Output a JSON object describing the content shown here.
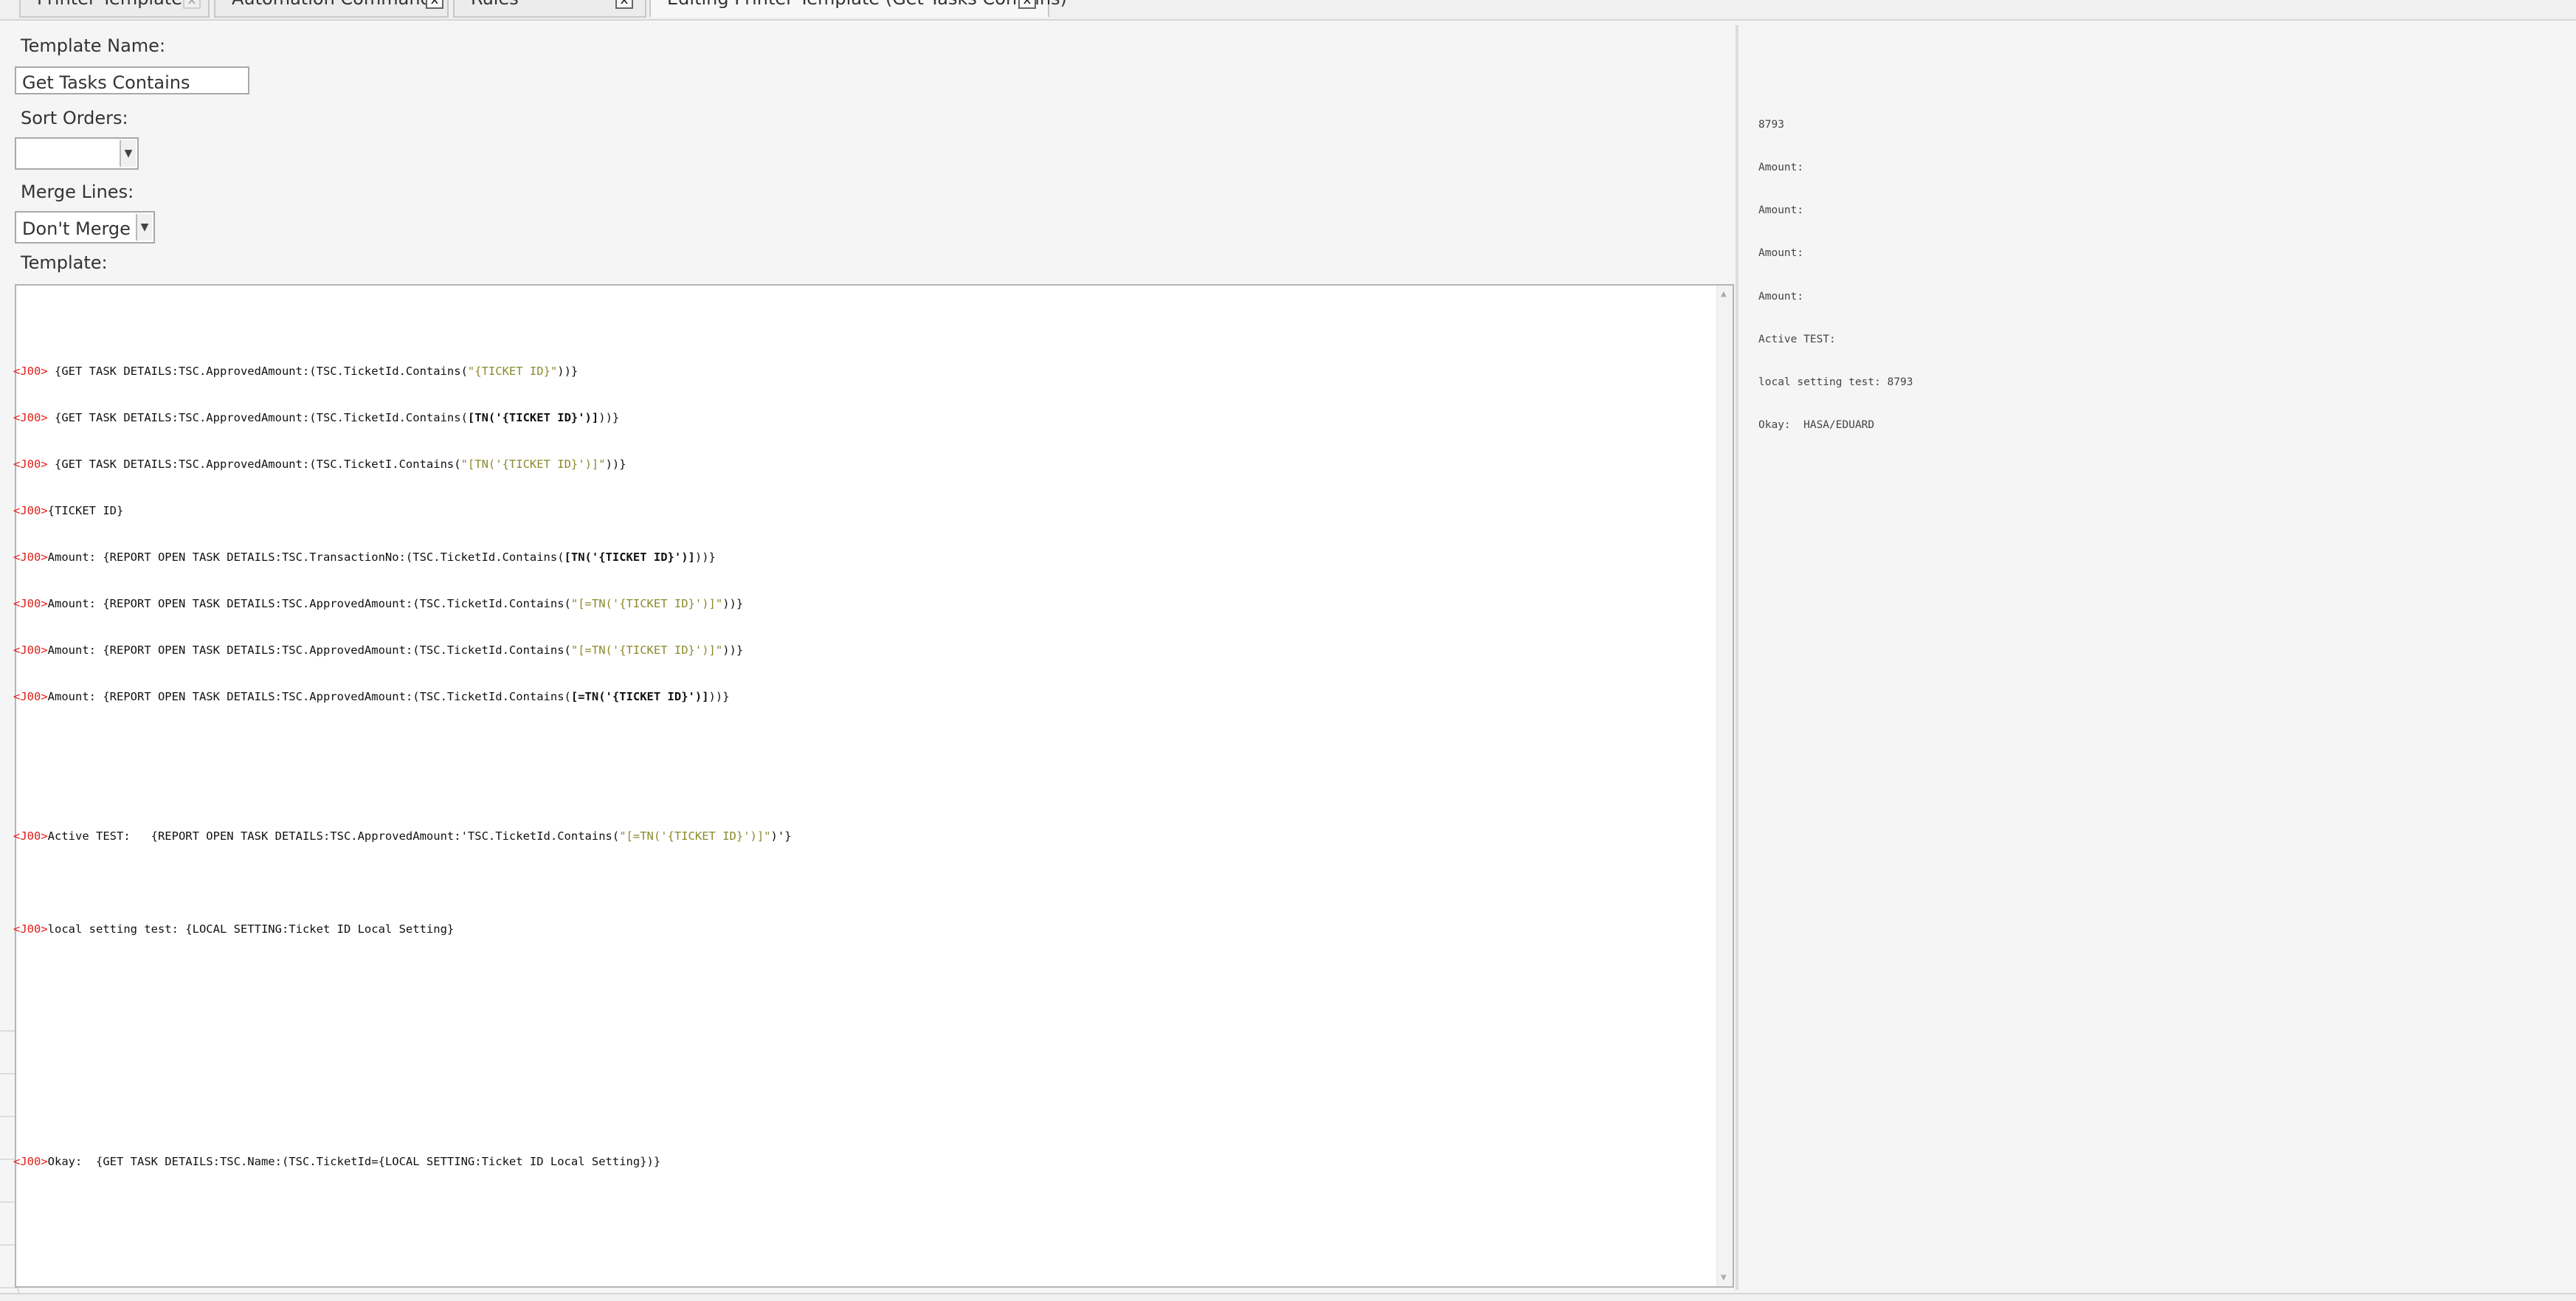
{
  "tabs": [
    {
      "label": "Printer Templates",
      "close": "x"
    },
    {
      "label": "Automation Commands",
      "close": "x"
    },
    {
      "label": "Rules",
      "close": "x"
    },
    {
      "label": "Editing Printer Template (Get Tasks Contains)",
      "close": "x"
    }
  ],
  "form": {
    "template_name_label": "Template Name:",
    "template_name_value": "Get Tasks Contains",
    "sort_orders_label": "Sort Orders:",
    "sort_orders_value": "",
    "merge_lines_label": "Merge Lines:",
    "merge_lines_value": "Don't Merge",
    "template_label": "Template:"
  },
  "template_lines": {
    "l1": {
      "tag": "<J00>",
      "a": " {GET TASK DETAILS:TSC.ApprovedAmount:(TSC.TicketId.Contains(",
      "s": "\"{TICKET ID}\"",
      "b": "))}"
    },
    "l2": {
      "tag": "<J00>",
      "a": " {GET TASK DETAILS:TSC.ApprovedAmount:(TSC.TicketId.Contains(",
      "bold": "[TN('{TICKET ID}')]",
      "b": "))}"
    },
    "l3": {
      "tag": "<J00>",
      "a": " {GET TASK DETAILS:TSC.ApprovedAmount:(TSC.TicketI.Contains(",
      "s": "\"[TN('{TICKET ID}')]\"",
      "b": "))}"
    },
    "l4": {
      "tag": "<J00>",
      "a": "{TICKET ID}"
    },
    "l5": {
      "tag": "<J00>",
      "a": "Amount: {REPORT OPEN TASK DETAILS:TSC.TransactionNo:(TSC.TicketId.Contains(",
      "bold": "[TN('{TICKET ID}')]",
      "b": "))}"
    },
    "l6": {
      "tag": "<J00>",
      "a": "Amount: {REPORT OPEN TASK DETAILS:TSC.ApprovedAmount:(TSC.TicketId.Contains(",
      "s": "\"[=TN('{TICKET ID}')]\"",
      "b": "))}"
    },
    "l7": {
      "tag": "<J00>",
      "a": "Amount: {REPORT OPEN TASK DETAILS:TSC.ApprovedAmount:(TSC.TicketId.Contains(",
      "s": "\"[=TN('{TICKET ID}')]\"",
      "b": "))}"
    },
    "l8": {
      "tag": "<J00>",
      "a": "Amount: {REPORT OPEN TASK DETAILS:TSC.ApprovedAmount:(TSC.TicketId.Contains(",
      "bold": "[=TN('{TICKET ID}')]",
      "b": "))}"
    },
    "l9": {
      "tag": "<J00>",
      "a": "Active TEST:   {REPORT OPEN TASK DETAILS:TSC.ApprovedAmount:'TSC.TicketId.Contains(",
      "s": "\"[=TN('{TICKET ID}')]\"",
      "b": ")'}"
    },
    "l10": {
      "tag": "<J00>",
      "a": "local setting test: {LOCAL SETTING:Ticket ID Local Setting}"
    },
    "l11": {
      "tag": "<J00>",
      "a": "Okay:  {GET TASK DETAILS:TSC.Name:(TSC.TicketId={LOCAL SETTING:Ticket ID Local Setting})}"
    }
  },
  "preview_lines": [
    "8793",
    "Amount:",
    "Amount:",
    "Amount:",
    "Amount:",
    "Active TEST:",
    "local setting test: 8793",
    "Okay:  HASA/EDUARD"
  ],
  "icons": {
    "tab_close": "close-icon",
    "combo_arrow": "chevron-down-icon"
  },
  "colors": {
    "tag": "#e0201b",
    "string": "#8a8a2e"
  }
}
